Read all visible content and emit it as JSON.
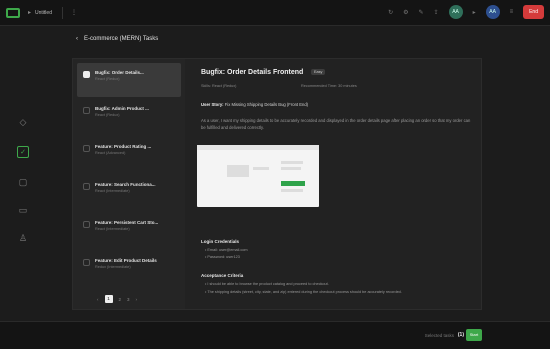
{
  "topbar": {
    "title": "Untitled",
    "avatars": [
      "AA",
      "AA"
    ],
    "end_label": "End"
  },
  "header": {
    "back_icon": "chevron-left-icon",
    "title": "E-commerce (MERN) Tasks"
  },
  "tasks": [
    {
      "title": "Bugfix: Order Details...",
      "sub": "React (Redux)",
      "checked": true
    },
    {
      "title": "Bugfix: Admin Product ...",
      "sub": "React (Redux)",
      "checked": false
    },
    {
      "title": "Feature: Product Rating ...",
      "sub": "React (Advanced)",
      "checked": false
    },
    {
      "title": "Feature: Search Functiona...",
      "sub": "React (Intermediate)",
      "checked": false
    },
    {
      "title": "Feature: Persistent Cart Sto...",
      "sub": "React (Intermediate)",
      "checked": false
    },
    {
      "title": "Feature: Edit Product Details",
      "sub": "Redux (Intermediate)",
      "checked": false
    }
  ],
  "pager": [
    "‹",
    "1",
    "2",
    "3",
    "›"
  ],
  "detail": {
    "title": "Bugfix: Order Details Frontend",
    "badge": "Easy",
    "meta1": "Skills: React (Redux)",
    "meta2": "Recommended Time: 30 minutes",
    "story_label": "User Story:",
    "story_text": "Fix Missing Shipping Details Bug (Front End)",
    "para": "As a user, I want my shipping details to be accurately recorded and displayed in the order details page after placing an order so that my order can be fulfilled and delivered correctly.",
    "login_heading": "Login Credentials",
    "login_items": [
      "Email: user@email.com",
      "Password: user123"
    ],
    "criteria_heading": "Acceptance Criteria",
    "criteria_items": [
      "I should be able to browse the product catalog and proceed to checkout.",
      "The shipping details (street, city, state, and zip) entered during the checkout process should be accurately recorded."
    ]
  },
  "footer": {
    "label": "Selected tasks",
    "count": "(1)",
    "button": "Start"
  }
}
